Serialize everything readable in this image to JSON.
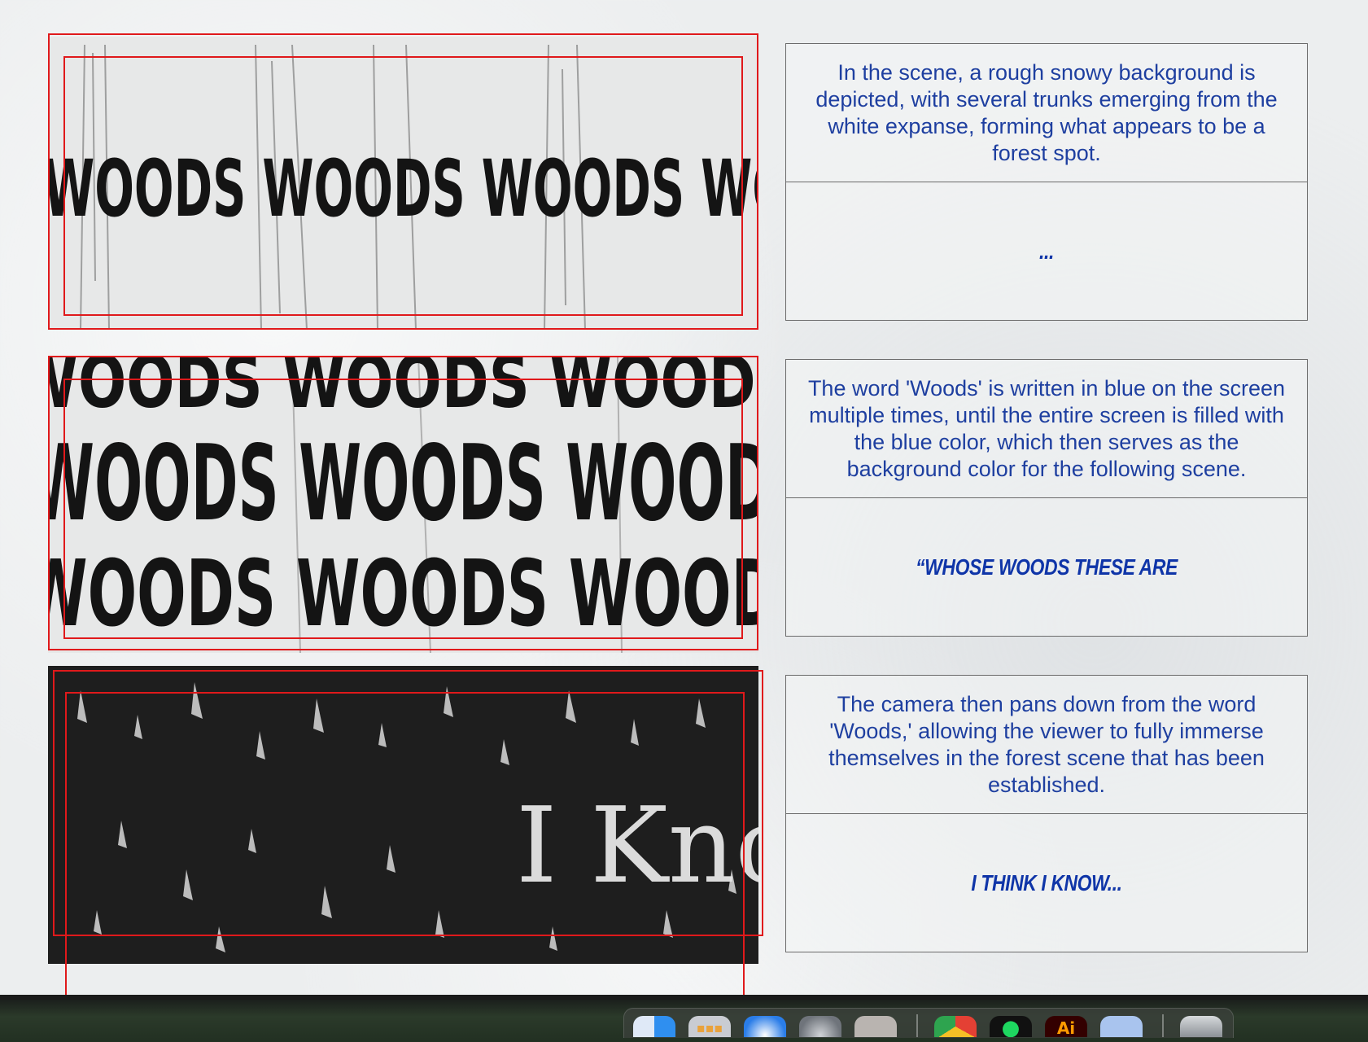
{
  "storyboard": [
    {
      "frame_lettering": "WOODS WOODS WOODS WO",
      "description": "In the scene, a rough snowy background is depicted, with several trunks emerging from the white expanse, forming what appears to be a forest spot.",
      "caption": "..."
    },
    {
      "frame_lettering": "WOODS WOODS WOODS",
      "description": "The word 'Woods' is written in blue on the screen multiple times, until the entire screen is filled with the blue color,  which then serves as the background color for the following scene.",
      "caption": "“Whose woods these are"
    },
    {
      "frame_lettering": "I Kno",
      "description": "The camera then pans down from the word 'Woods,' allowing the viewer to fully immerse themselves in the forest scene that has been established.",
      "caption": "I think I know..."
    }
  ],
  "colors": {
    "description_text": "#1e3fa0",
    "caption_text": "#0f35a8",
    "guide_lines": "#e0191b",
    "panel_border": "#6b6b6b"
  },
  "dock": {
    "apps": [
      {
        "name": "Finder",
        "icon": "finder-icon",
        "color": "#2f8ff0"
      },
      {
        "name": "Launchpad",
        "icon": "launchpad-icon",
        "color": "#c9ccd2"
      },
      {
        "name": "Safari",
        "icon": "safari-icon",
        "color": "#2a7de8"
      },
      {
        "name": "System Settings",
        "icon": "settings-gear-icon",
        "color": "#8a8f96"
      },
      {
        "name": "iPhone Mirroring",
        "icon": "iphone-icon",
        "color": "#b9b4b0"
      },
      {
        "name": "Chrome",
        "icon": "chrome-icon",
        "color": "#e44034"
      },
      {
        "name": "Spotify",
        "icon": "spotify-icon",
        "color": "#1ed760"
      },
      {
        "name": "Illustrator",
        "icon": "illustrator-icon",
        "color": "#330000",
        "label": "Ai"
      },
      {
        "name": "Preview",
        "icon": "preview-icon",
        "color": "#a9c4ee"
      },
      {
        "name": "Trash",
        "icon": "trash-icon",
        "color": "#9ea3a8"
      }
    ]
  }
}
